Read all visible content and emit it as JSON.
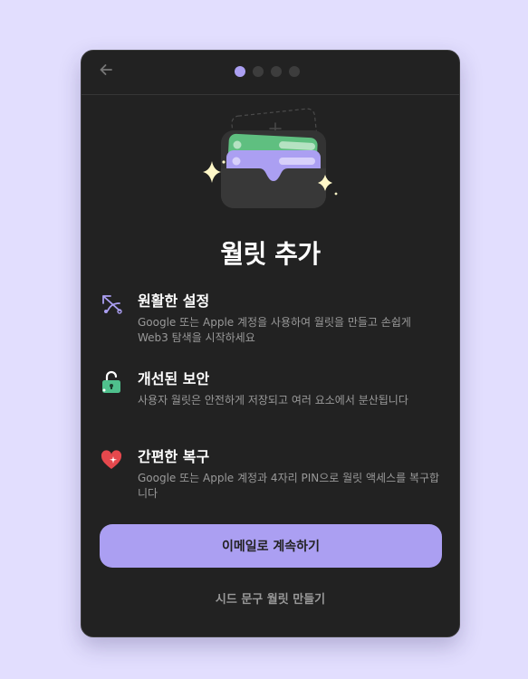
{
  "header": {
    "back_icon": "arrow-left-icon",
    "step_count": 4,
    "current_step": 1
  },
  "hero": {
    "icon": "wallet-add-icon"
  },
  "title": "월릿 추가",
  "features": [
    {
      "icon": "setup-icon",
      "title": "원활한 설정",
      "description": "Google 또는 Apple 계정을 사용하여 월릿을 만들고 손쉽게 Web3 탐색을 시작하세요"
    },
    {
      "icon": "lock-icon",
      "title": "개선된 보안",
      "description": "사용자 월릿은 안전하게 저장되고 여러 요소에서 분산됩니다"
    },
    {
      "icon": "heart-icon",
      "title": "간편한 복구",
      "description": "Google 또는 Apple 계정과 4자리 PIN으로 월릿 액세스를 복구합니다"
    }
  ],
  "actions": {
    "primary_label": "이메일로 계속하기",
    "secondary_label": "시드 문구 월릿 만들기"
  },
  "colors": {
    "page_background": "#e2defe",
    "modal_background": "#222222",
    "accent": "#ab9ff2",
    "green": "#4fc08d",
    "red": "#e5484d",
    "muted_text": "#999999"
  }
}
